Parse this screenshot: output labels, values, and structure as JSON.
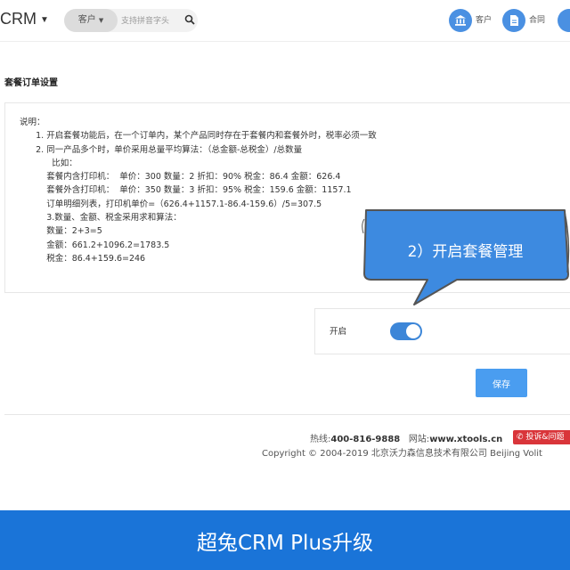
{
  "header": {
    "brand": "CRM",
    "search": {
      "type_label": "客户",
      "placeholder": "支持拼音字头"
    },
    "nav": [
      {
        "label": "客户",
        "icon": "bank-icon"
      },
      {
        "label": "合同",
        "icon": "document-icon"
      }
    ]
  },
  "section_title": "套餐订单设置",
  "description": "说明：\n      1. 开启套餐功能后，在一个订单内，某个产品同时存在于套餐内和套餐外时，税率必须一致\n      2. 同一产品多个时，单价采用总量平均算法：（总金额-总税金）/总数量\n            比如：\n          套餐内含打印机：  单价：300 数量：2 折扣：90% 税金：86.4 金额：626.4\n          套餐外含打印机：  单价：350 数量：3 折扣：95% 税金：159.6 金额：1157.1\n          订单明细列表，打印机单价=（626.4+1157.1-86.4-159.6）/5=307.5\n          3.数量、金额、税金采用求和算法：\n          数量：2+3=5\n          金额：661.2+1096.2=1783.5\n          税金：86.4+159.6=246",
  "callout": "2）开启套餐管理",
  "toggle": {
    "label": "开启",
    "state": "on"
  },
  "save_label": "保存",
  "footer": {
    "hotline_label": "热线:",
    "hotline": "400-816-9888",
    "site_label": "网站:",
    "site": "www.xtools.cn",
    "complain": "投诉&问题",
    "copyright": "Copyright © 2004-2019  北京沃力森信息技术有限公司  Beijing Volit"
  },
  "banner": "超兔CRM Plus升级",
  "colors": {
    "accent": "#4a90e2",
    "banner": "#1a74d8",
    "complain": "#d9353a"
  }
}
